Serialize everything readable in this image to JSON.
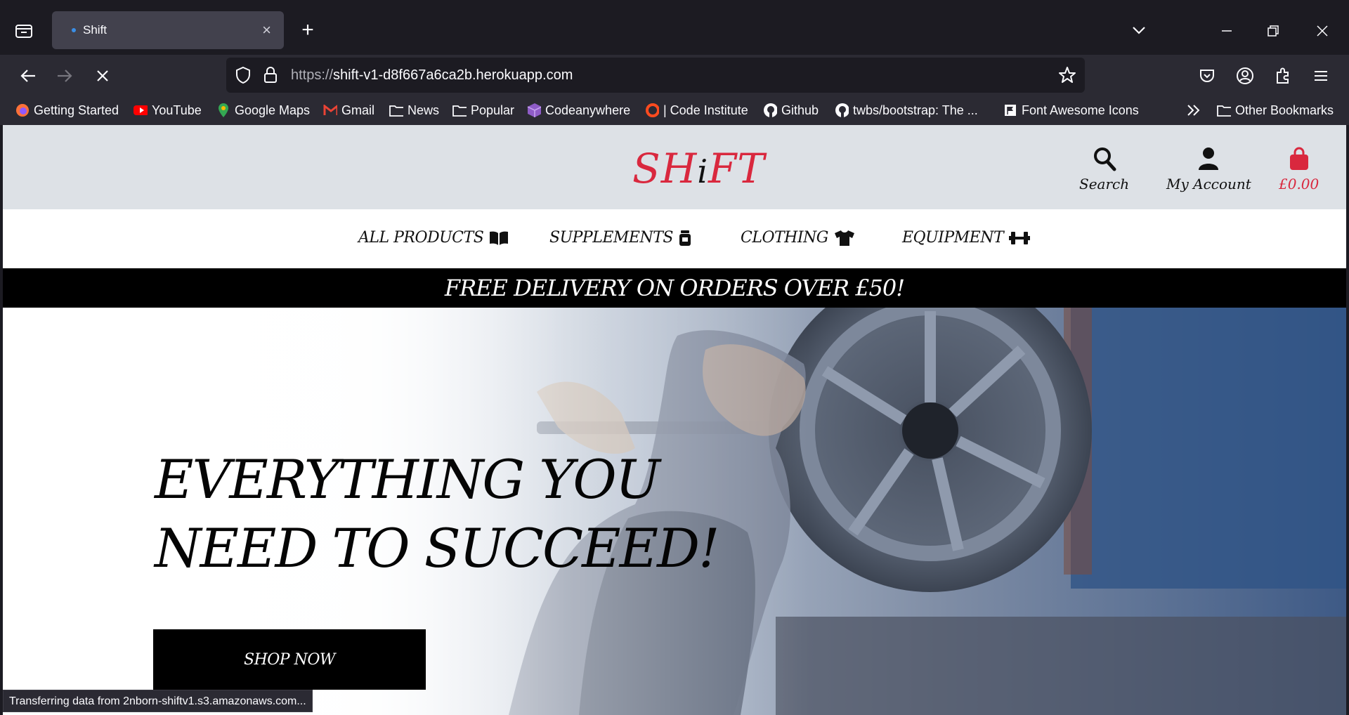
{
  "browser": {
    "tab_title": "Shift",
    "url_scheme": "https://",
    "url_host": "shift-v1-d8f667a6ca2b.herokuapp.com",
    "bookmarks": [
      "Getting Started",
      "YouTube",
      "Google Maps",
      "Gmail",
      "News",
      "Popular",
      "Codeanywhere",
      "| Code Institute",
      "Github",
      "twbs/bootstrap: The ...",
      "Font Awesome Icons"
    ],
    "other_bookmarks": "Other Bookmarks",
    "status_text": "Transferring data from 2nborn-shiftv1.s3.amazonaws.com..."
  },
  "site": {
    "logo_a": "SH",
    "logo_i": "i",
    "logo_b": "FT",
    "header": {
      "search_label": "Search",
      "account_label": "My Account",
      "bag_total": "£0.00"
    },
    "nav": [
      {
        "label": "ALL PRODUCTS",
        "icon": "book-open-icon"
      },
      {
        "label": "SUPPLEMENTS",
        "icon": "jar-icon"
      },
      {
        "label": "CLOTHING",
        "icon": "tshirt-icon"
      },
      {
        "label": "EQUIPMENT",
        "icon": "dumbbell-icon"
      }
    ],
    "promo": "FREE DELIVERY ON ORDERS OVER £50!",
    "hero": {
      "line1": "EVERYTHING YOU",
      "line2": "NEED TO SUCCEED!",
      "cta": "SHOP NOW"
    }
  },
  "colors": {
    "brand_red": "#d9283e",
    "header_bg": "#dde1e6",
    "chrome_dark": "#1c1b22",
    "chrome_mid": "#2b2a33"
  }
}
